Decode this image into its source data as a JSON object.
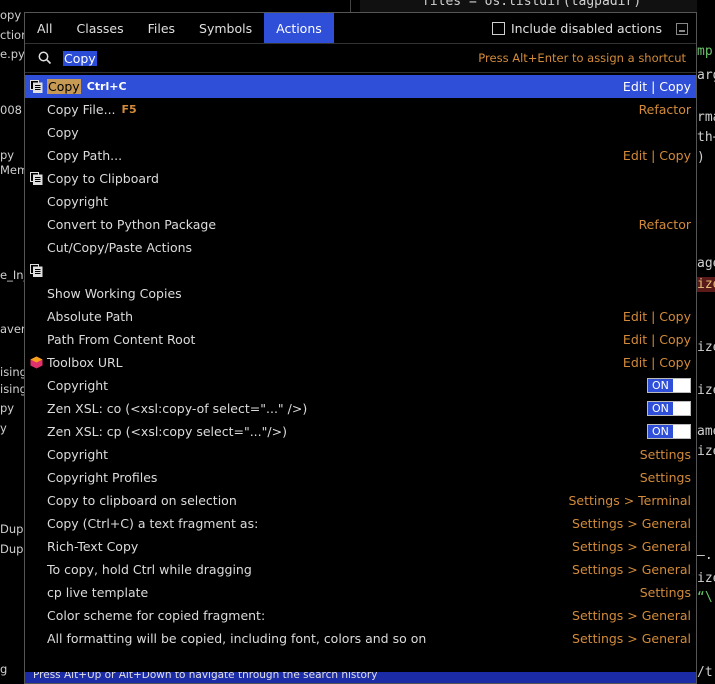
{
  "background": {
    "left_fragments": [
      "opy",
      "ction_",
      "e.py",
      "008",
      "py",
      "Mem",
      "e_In_",
      "avert",
      "ising",
      "ising",
      "py",
      "y",
      "Dupli",
      "Dupli",
      "g"
    ],
    "right_fragments": [
      "mp'",
      "arg",
      "rma",
      "th+",
      ")",
      "age",
      "ize",
      "ize",
      "ize",
      "ame",
      "ize",
      "—.",
      "ize",
      "“\\",
      "/t"
    ],
    "top_code": "files = os.listdir(tagpadir)"
  },
  "tabs": [
    {
      "label": "All",
      "active": false
    },
    {
      "label": "Classes",
      "active": false
    },
    {
      "label": "Files",
      "active": false
    },
    {
      "label": "Symbols",
      "active": false
    },
    {
      "label": "Actions",
      "active": true
    }
  ],
  "include_disabled_label": "Include disabled actions",
  "search": {
    "query": "Copy",
    "hint": "Press Alt+Enter to assign a shortcut"
  },
  "rows": [
    {
      "icon": "copy-icon",
      "name": "Copy",
      "shortcut": "Ctrl+C",
      "right": "Edit | Copy",
      "selected": true
    },
    {
      "icon": "",
      "name": "Copy File...",
      "shortcut": "F5",
      "right": "Refactor"
    },
    {
      "icon": "",
      "name": "Copy",
      "right": ""
    },
    {
      "icon": "",
      "name": "Copy Path...",
      "right": "Edit | Copy"
    },
    {
      "icon": "copy-icon",
      "name": "Copy to Clipboard",
      "right": ""
    },
    {
      "icon": "",
      "name": "Copyright",
      "right": ""
    },
    {
      "icon": "",
      "name": "Convert to Python Package",
      "right": "Refactor"
    },
    {
      "icon": "",
      "name": "Cut/Copy/Paste Actions",
      "right": ""
    },
    {
      "icon": "copy-icon",
      "name": "",
      "right": ""
    },
    {
      "icon": "",
      "name": "Show Working Copies",
      "right": ""
    },
    {
      "icon": "",
      "name": "Absolute Path",
      "right": "Edit | Copy"
    },
    {
      "icon": "",
      "name": "Path From Content Root",
      "right": "Edit | Copy"
    },
    {
      "icon": "toolbox-icon",
      "name": "Toolbox URL",
      "right": "Edit | Copy"
    },
    {
      "icon": "",
      "name": "Copyright",
      "toggle": "ON"
    },
    {
      "icon": "",
      "name": "Zen XSL: co (<xsl:copy-of select=\"...\" />)",
      "toggle": "ON"
    },
    {
      "icon": "",
      "name": "Zen XSL: cp (<xsl:copy select=\"...\"/>)",
      "toggle": "ON"
    },
    {
      "icon": "",
      "name": "Copyright",
      "right": "Settings"
    },
    {
      "icon": "",
      "name": "Copyright Profiles",
      "right": "Settings"
    },
    {
      "icon": "",
      "name": "Copy to clipboard on selection",
      "right": "Settings > Terminal"
    },
    {
      "icon": "",
      "name": "Copy (Ctrl+C) a text fragment as:",
      "right": "Settings > General"
    },
    {
      "icon": "",
      "name": "Rich-Text Copy",
      "right": "Settings > General"
    },
    {
      "icon": "",
      "name": "To copy, hold Ctrl while dragging",
      "right": "Settings > General"
    },
    {
      "icon": "",
      "name": "cp live template",
      "right": "Settings"
    },
    {
      "icon": "",
      "name": "Color scheme for copied fragment:",
      "right": "Settings > General"
    },
    {
      "icon": "",
      "name": "All formatting will be copied, including font, colors and so on",
      "right": "Settings > General"
    }
  ],
  "footer": "Press Alt+Up or Alt+Down to navigate through the search history",
  "colors": {
    "accent": "#2f4fd8",
    "category": "#d38b3a",
    "highlight": "#c69a55"
  }
}
